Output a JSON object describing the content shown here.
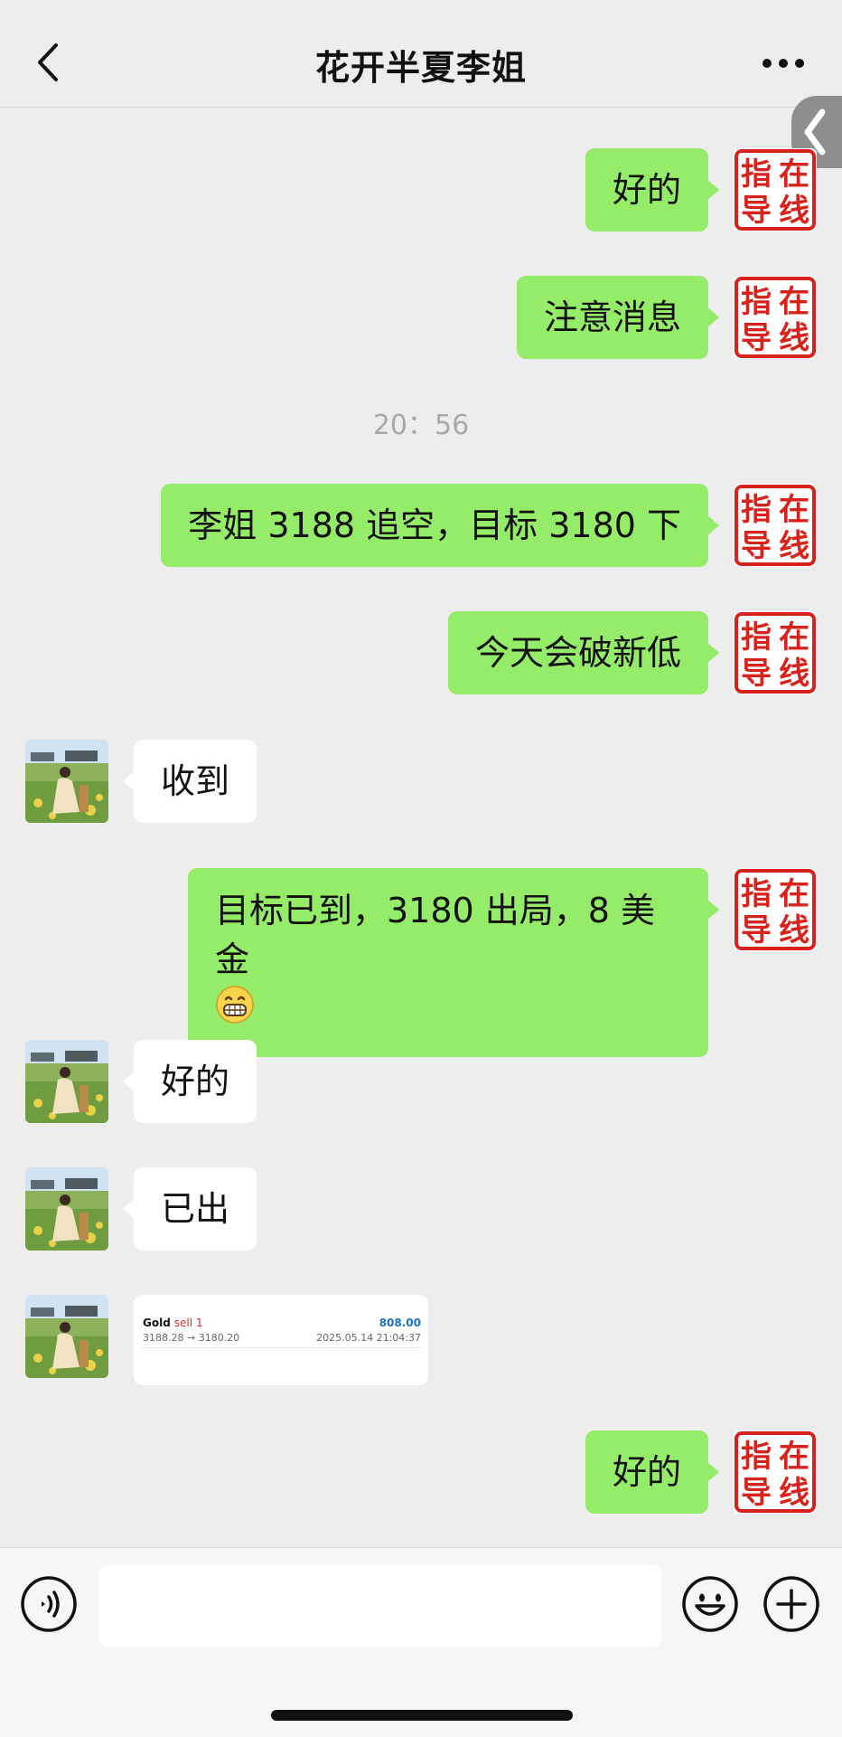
{
  "header": {
    "title": "花开半夏李姐"
  },
  "colors": {
    "bubble_me": "#95ec69",
    "bubble_other": "#ffffff",
    "seal_red": "#d8231d",
    "background": "#ededed"
  },
  "seal_avatar": {
    "chars": [
      "在",
      "指",
      "线",
      "导"
    ]
  },
  "messages": [
    {
      "from": "me",
      "text": "好的"
    },
    {
      "from": "me",
      "text": "注意消息"
    },
    {
      "type": "time",
      "text": "20：56"
    },
    {
      "from": "me",
      "text": "李姐 3188 追空，目标 3180 下"
    },
    {
      "from": "me",
      "text": "今天会破新低"
    },
    {
      "from": "other",
      "text": "收到"
    },
    {
      "from": "me",
      "text": "目标已到，3180 出局，8 美金",
      "emoji": "grin-icon"
    },
    {
      "from": "other",
      "text": "好的"
    },
    {
      "from": "other",
      "text": "已出"
    },
    {
      "from": "other",
      "type": "trade_card"
    },
    {
      "from": "me",
      "text": "好的"
    }
  ],
  "trade": {
    "symbol": "Gold",
    "side": "sell 1",
    "profit": "808.00",
    "prices": "3188.28 → 3180.20",
    "datetime": "2025.05.14 21:04:37"
  },
  "input": {
    "value": ""
  }
}
